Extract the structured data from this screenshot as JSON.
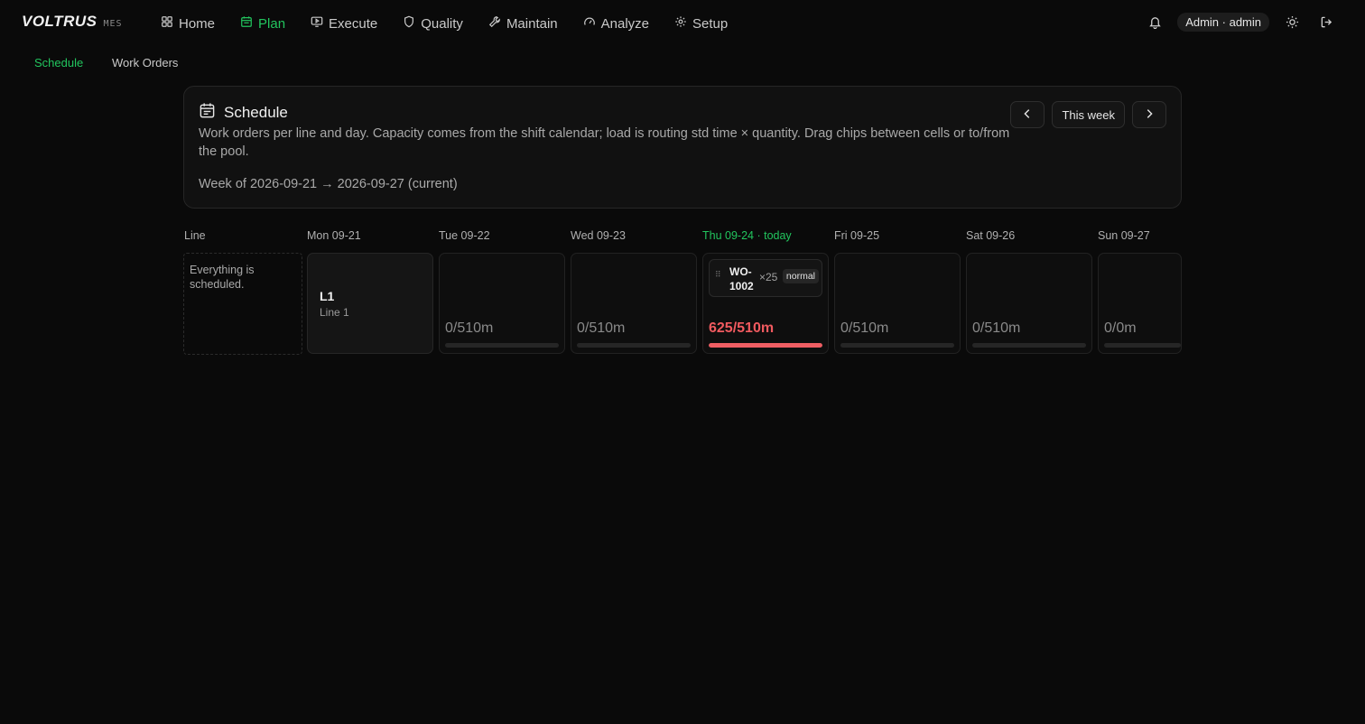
{
  "brand": {
    "name": "VOLTRUS",
    "suffix": "MES"
  },
  "nav": [
    {
      "label": "Home",
      "icon": "grid-icon"
    },
    {
      "label": "Plan",
      "icon": "calendar-icon",
      "active": true
    },
    {
      "label": "Execute",
      "icon": "monitor-play-icon"
    },
    {
      "label": "Quality",
      "icon": "shield-icon"
    },
    {
      "label": "Maintain",
      "icon": "wrench-icon"
    },
    {
      "label": "Analyze",
      "icon": "gauge-icon"
    },
    {
      "label": "Setup",
      "icon": "gear-icon"
    }
  ],
  "user": {
    "label": "Admin · admin"
  },
  "subnav": [
    {
      "label": "Schedule",
      "active": true
    },
    {
      "label": "Work Orders"
    }
  ],
  "header": {
    "title": "Schedule",
    "description": "Work orders per line and day. Capacity comes from the shift calendar; load is routing std time × quantity. Drag chips between cells or to/from the pool.",
    "week": "Week of 2026-09-21 → 2026-09-27 (current)",
    "this_week_label": "This week"
  },
  "grid": {
    "line_header": "Line",
    "pool_text": "Everything is scheduled.",
    "days": [
      {
        "label": "Mon 09-21"
      },
      {
        "label": "Tue 09-22"
      },
      {
        "label": "Wed 09-23"
      },
      {
        "label": "Thu 09-24 · today",
        "today": true
      },
      {
        "label": "Fri 09-25"
      },
      {
        "label": "Sat 09-26"
      },
      {
        "label": "Sun 09-27"
      }
    ],
    "line": {
      "code": "L1",
      "name": "Line 1"
    },
    "cells": [
      {
        "load": "0/510m",
        "fill": 0
      },
      {
        "load": "0/510m",
        "fill": 0
      },
      {
        "load": "625/510m",
        "fill": 1,
        "over": true,
        "chip": {
          "id": "WO-1002",
          "qty": "×25",
          "priority": "normal"
        }
      },
      {
        "load": "0/510m",
        "fill": 0
      },
      {
        "load": "0/510m",
        "fill": 0
      },
      {
        "load": "0/0m",
        "fill": 0
      }
    ]
  },
  "colors": {
    "accent": "#22c55e",
    "overload": "#ef5e63"
  }
}
